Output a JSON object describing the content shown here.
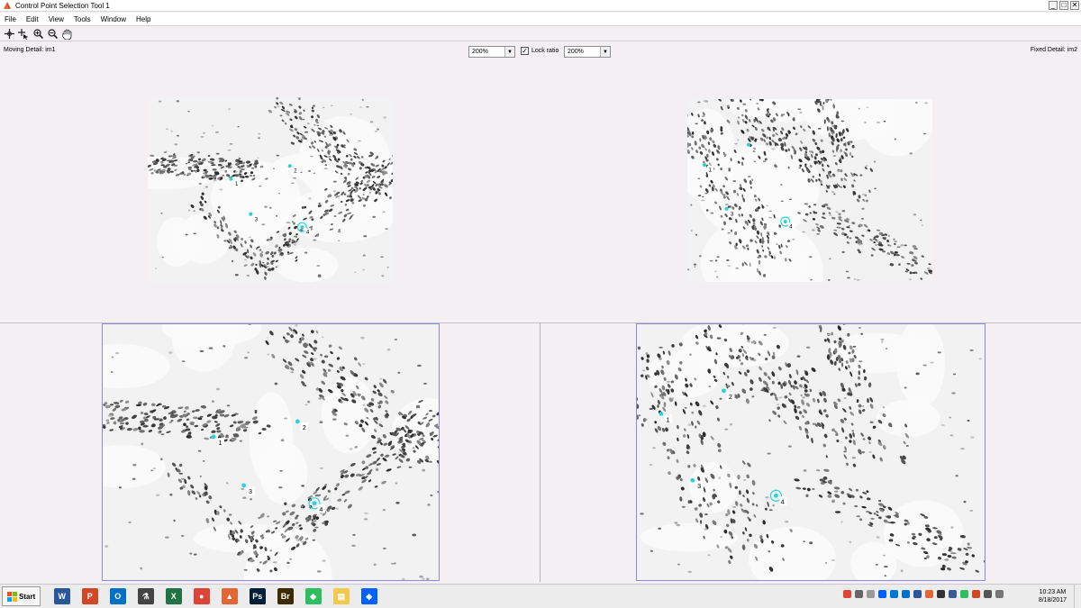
{
  "window": {
    "title": "Control Point Selection Tool 1",
    "controls": [
      "_",
      "□",
      "✕"
    ]
  },
  "menu": [
    "File",
    "Edit",
    "View",
    "Tools",
    "Window",
    "Help"
  ],
  "toolbar": {
    "icons": [
      "add-point-icon",
      "select-point-icon",
      "zoom-in-icon",
      "zoom-out-icon",
      "pan-hand-icon"
    ]
  },
  "detail": {
    "moving_label": "Moving Detail: im1",
    "fixed_label": "Fixed Detail: im2",
    "moving_zoom": "200%",
    "fixed_zoom": "200%",
    "lock_ratio_label": "Lock ratio",
    "lock_ratio_checked": true
  },
  "points": {
    "moving": [
      "1",
      "2",
      "3",
      "4"
    ],
    "fixed": [
      "1",
      "2",
      "3",
      "4"
    ],
    "marker_color": "#2ad3d8"
  },
  "taskbar": {
    "start_label": "Start",
    "apps": [
      {
        "name": "word-icon",
        "glyph": "W",
        "color": "#2b579a"
      },
      {
        "name": "powerpoint-icon",
        "glyph": "P",
        "color": "#d24726"
      },
      {
        "name": "outlook-icon",
        "glyph": "O",
        "color": "#0072c6"
      },
      {
        "name": "microscope-icon",
        "glyph": "⚗",
        "color": "#444444"
      },
      {
        "name": "excel-icon",
        "glyph": "X",
        "color": "#217346"
      },
      {
        "name": "chrome-icon",
        "glyph": "●",
        "color": "#db4437"
      },
      {
        "name": "matlab-icon",
        "glyph": "▲",
        "color": "#e16737"
      },
      {
        "name": "photoshop-icon",
        "glyph": "Ps",
        "color": "#001e36"
      },
      {
        "name": "bridge-icon",
        "glyph": "Br",
        "color": "#3e2a00"
      },
      {
        "name": "evernote-icon",
        "glyph": "◆",
        "color": "#2dbe60"
      },
      {
        "name": "file-explorer-icon",
        "glyph": "▤",
        "color": "#f2c94c"
      },
      {
        "name": "dropbox-icon",
        "glyph": "◈",
        "color": "#0061ff"
      }
    ],
    "time": "10:23 AM",
    "date": "8/18/2017"
  }
}
